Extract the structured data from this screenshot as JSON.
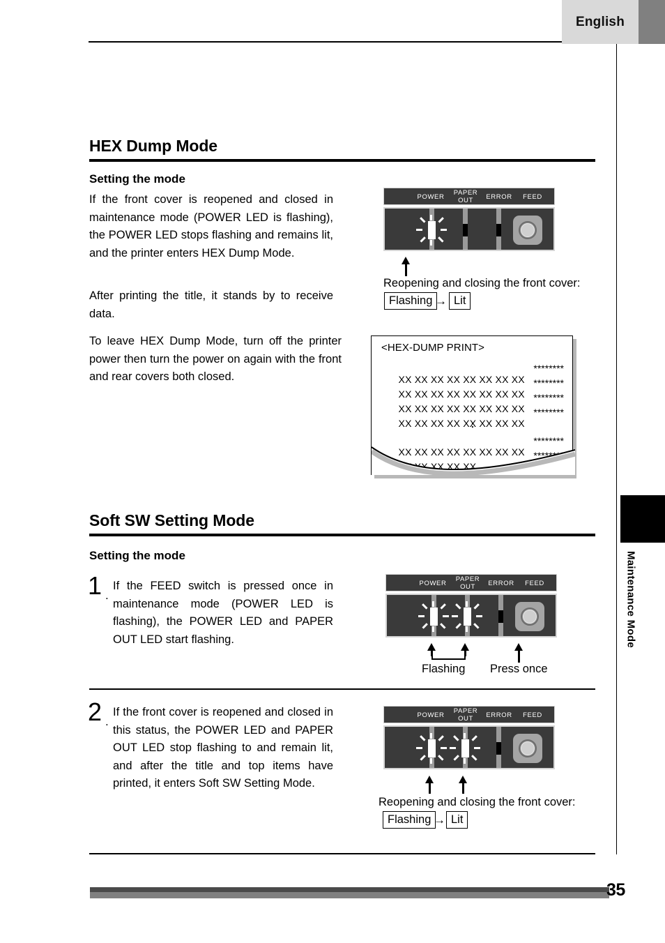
{
  "header": {
    "language_tab": "English"
  },
  "spine": {
    "chapter_label": "Maintenance Mode"
  },
  "sections": [
    {
      "title": "HEX Dump Mode",
      "subtitle": "Setting the mode",
      "paragraphs": [
        "If the front cover is reopened and closed in maintenance mode (POWER LED is flashing), the POWER LED stops flashing and remains lit, and the printer enters HEX Dump Mode.",
        "After printing the title, it stands by to receive data.",
        "To leave HEX Dump Mode, turn off the printer power then turn the power on again with the front and rear covers both closed."
      ]
    },
    {
      "title": "Soft SW Setting Mode",
      "subtitle": "Setting the mode",
      "steps": [
        {
          "number": "1",
          "dot": ".",
          "text": "If the FEED switch is pressed once in maintenance mode (POWER LED is flashing), the POWER LED and PAPER OUT LED start flashing."
        },
        {
          "number": "2",
          "dot": ".",
          "text": "If the front cover is reopened and closed in this status, the POWER LED and PAPER OUT LED stop flashing to and remain lit, and after the title and top items have printed, it enters Soft SW Setting Mode."
        }
      ]
    }
  ],
  "panel_labels": {
    "power": "POWER",
    "paper": "PAPER",
    "out": "OUT",
    "error": "ERROR",
    "feed": "FEED"
  },
  "panels": [
    {
      "id": "hex-dump-panel",
      "leds": [
        "flashing",
        "off",
        "off"
      ],
      "captions": {
        "main": "Reopening and closing the front cover:",
        "from": "Flashing",
        "arrow": "→",
        "to": "Lit"
      }
    },
    {
      "id": "softsw-step1-panel",
      "leds": [
        "flashing",
        "flashing",
        "off"
      ],
      "captions": {
        "flashing": "Flashing",
        "press": "Press once"
      }
    },
    {
      "id": "softsw-step2-panel",
      "leds": [
        "flashing",
        "flashing",
        "off"
      ],
      "captions": {
        "main": "Reopening and closing the front cover:",
        "from": "Flashing",
        "arrow": "→",
        "to": "Lit"
      }
    }
  ],
  "receipt": {
    "title": "<HEX-DUMP PRINT>",
    "lines": [
      {
        "hex": "XX XX XX XX XX XX XX XX",
        "stars": "********"
      },
      {
        "hex": "XX XX XX XX XX XX XX XX",
        "stars": "********"
      },
      {
        "hex": "XX XX XX XX XX XX XX XX",
        "stars": "********"
      },
      {
        "hex": "XX XX XX XX XX XX XX XX",
        "stars": "********"
      }
    ],
    "ellipsis": ":",
    "lines_after": [
      {
        "hex": "XX XX XX XX XX XX XX XX",
        "stars": "********"
      },
      {
        "hex": "XX XX XX XX XX",
        "stars": "********"
      }
    ]
  },
  "footer": {
    "page_number": "35"
  }
}
